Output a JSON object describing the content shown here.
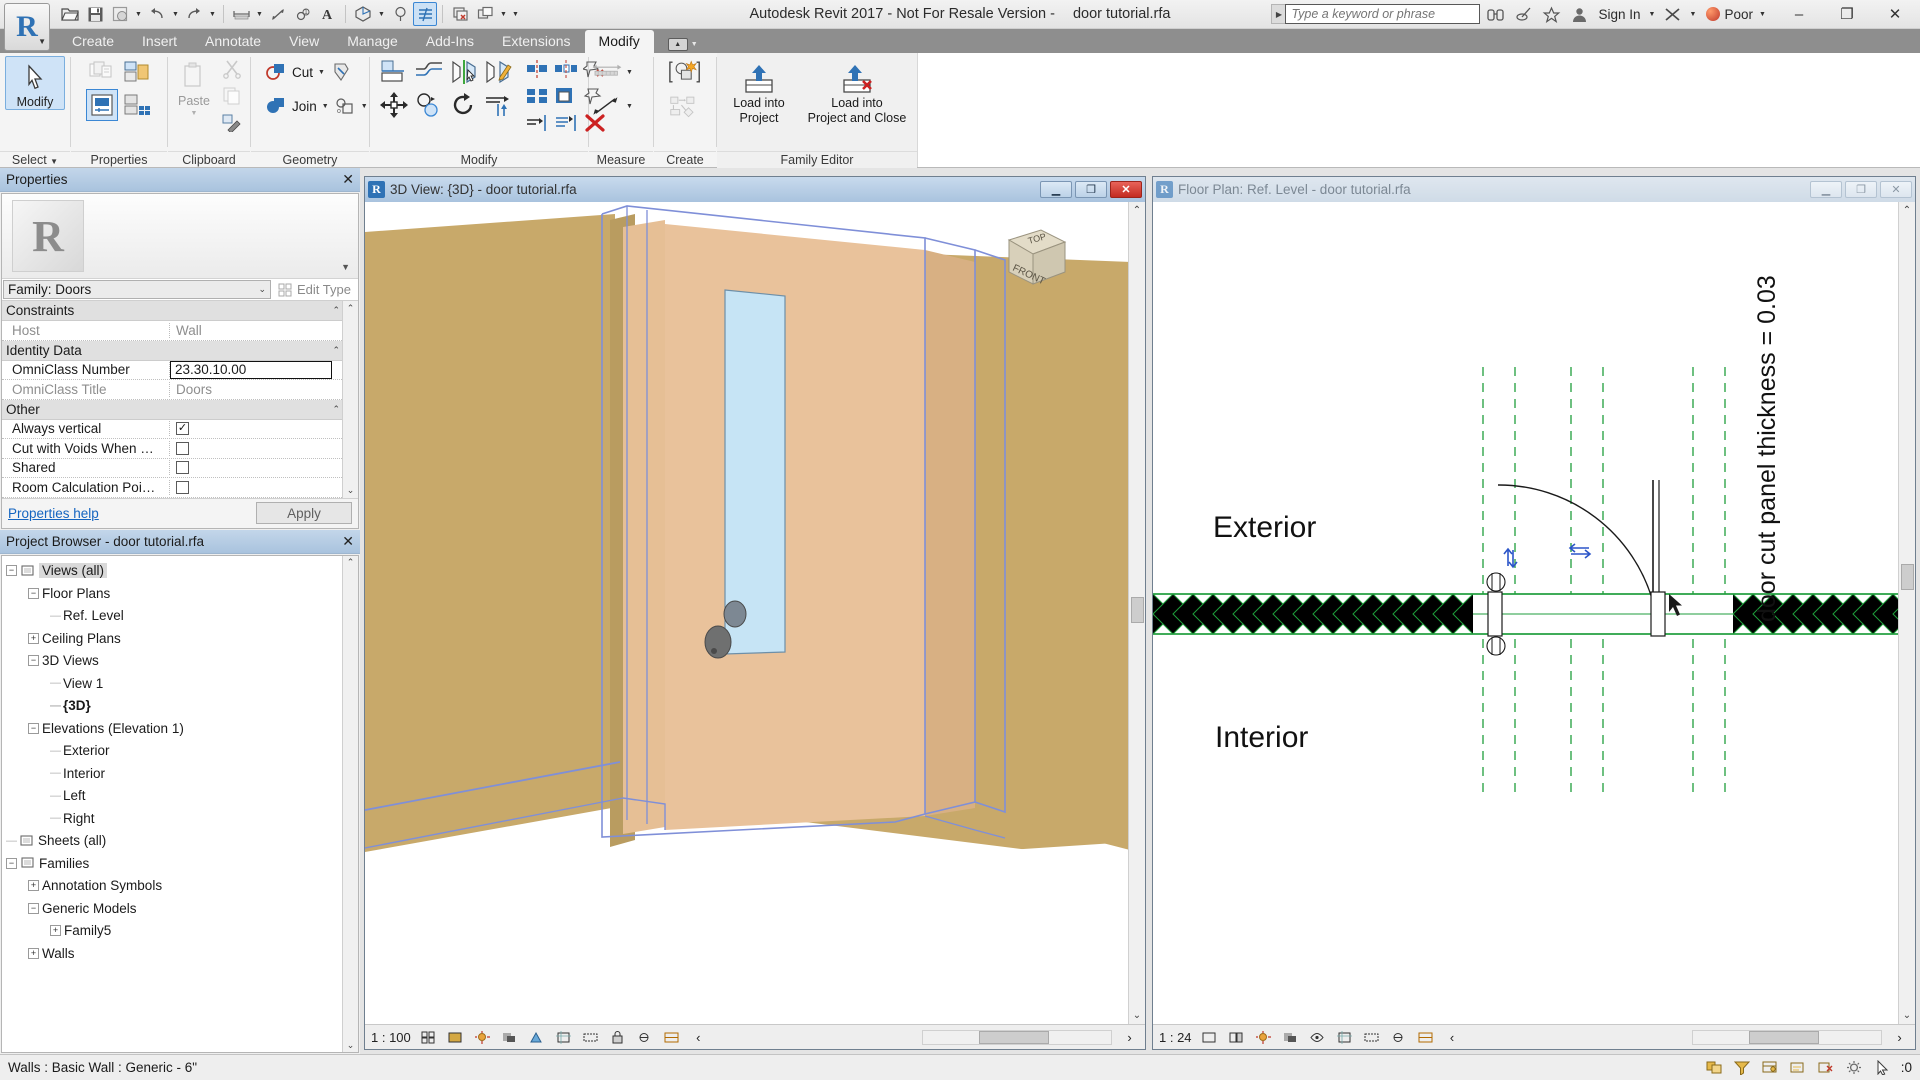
{
  "titlebar": {
    "app_title": "Autodesk Revit 2017 - Not For Resale Version -",
    "file_name": "door tutorial.rfa",
    "search_placeholder": "Type a keyword or phrase",
    "sign_in": "Sign In",
    "quality_label": "Poor",
    "quick_access": [
      {
        "name": "open-icon"
      },
      {
        "name": "save-icon"
      },
      {
        "name": "save-as-icon"
      },
      {
        "name": "undo-icon"
      },
      {
        "name": "redo-icon"
      },
      {
        "name": "measure-icon"
      },
      {
        "name": "aligned-dimension-icon"
      },
      {
        "name": "tag-icon"
      },
      {
        "name": "text-icon"
      },
      {
        "name": "default-3d-view-icon"
      },
      {
        "name": "section-icon"
      },
      {
        "name": "thin-lines-icon"
      },
      {
        "name": "close-hidden-windows-icon"
      },
      {
        "name": "switch-windows-icon"
      }
    ],
    "window_buttons": {
      "minimize": "–",
      "maximize": "❐",
      "close": "✕"
    }
  },
  "ribbon": {
    "tabs": [
      {
        "label": "Create",
        "active": false
      },
      {
        "label": "Insert",
        "active": false
      },
      {
        "label": "Annotate",
        "active": false
      },
      {
        "label": "View",
        "active": false
      },
      {
        "label": "Manage",
        "active": false
      },
      {
        "label": "Add-Ins",
        "active": false
      },
      {
        "label": "Extensions",
        "active": false
      },
      {
        "label": "Modify",
        "active": true
      }
    ],
    "panels": [
      {
        "label": "Select"
      },
      {
        "label": "Properties"
      },
      {
        "label": "Clipboard"
      },
      {
        "label": "Geometry"
      },
      {
        "label": "Modify"
      },
      {
        "label": "Measure"
      },
      {
        "label": "Create"
      },
      {
        "label": "Family Editor"
      }
    ],
    "modify_button": "Modify",
    "paste_button": "Paste",
    "cut_button": "Cut",
    "join_button": "Join",
    "load_into_project": "Load into\nProject",
    "load_into_project_l1": "Load into",
    "load_into_project_l2": "Project",
    "load_into_project_and_close_l1": "Load into",
    "load_into_project_and_close_l2": "Project and Close"
  },
  "properties": {
    "panel_title": "Properties",
    "family_selector": "Family: Doors",
    "edit_type_label": "Edit Type",
    "groups": [
      {
        "name": "Constraints",
        "rows": [
          {
            "name": "Host",
            "value": "Wall",
            "type": "text",
            "dim": true
          }
        ]
      },
      {
        "name": "Identity Data",
        "rows": [
          {
            "name": "OmniClass Number",
            "value": "23.30.10.00",
            "type": "text",
            "editing": true
          },
          {
            "name": "OmniClass Title",
            "value": "Doors",
            "type": "text",
            "dim": true
          }
        ]
      },
      {
        "name": "Other",
        "rows": [
          {
            "name": "Always vertical",
            "value": "",
            "type": "checkbox",
            "checked": true
          },
          {
            "name": "Cut with Voids When …",
            "value": "",
            "type": "checkbox",
            "checked": false
          },
          {
            "name": "Shared",
            "value": "",
            "type": "checkbox",
            "checked": false
          },
          {
            "name": "Room Calculation Poi…",
            "value": "",
            "type": "checkbox",
            "checked": false
          }
        ]
      }
    ],
    "help_link": "Properties help",
    "apply_button": "Apply"
  },
  "project_browser": {
    "panel_title": "Project Browser - door tutorial.rfa",
    "tree": [
      {
        "label": "Views (all)",
        "depth": 0,
        "expander": "minus",
        "icon": "views-icon",
        "selected": true
      },
      {
        "label": "Floor Plans",
        "depth": 1,
        "expander": "minus"
      },
      {
        "label": "Ref. Level",
        "depth": 2,
        "expander": "none"
      },
      {
        "label": "Ceiling Plans",
        "depth": 1,
        "expander": "plus"
      },
      {
        "label": "3D Views",
        "depth": 1,
        "expander": "minus"
      },
      {
        "label": "View 1",
        "depth": 2,
        "expander": "none"
      },
      {
        "label": "{3D}",
        "depth": 2,
        "expander": "none",
        "bold": true
      },
      {
        "label": "Elevations (Elevation 1)",
        "depth": 1,
        "expander": "minus"
      },
      {
        "label": "Exterior",
        "depth": 2,
        "expander": "none"
      },
      {
        "label": "Interior",
        "depth": 2,
        "expander": "none"
      },
      {
        "label": "Left",
        "depth": 2,
        "expander": "none"
      },
      {
        "label": "Right",
        "depth": 2,
        "expander": "none"
      },
      {
        "label": "Sheets (all)",
        "depth": 0,
        "expander": "none",
        "icon": "sheets-icon"
      },
      {
        "label": "Families",
        "depth": 0,
        "expander": "minus",
        "icon": "families-icon"
      },
      {
        "label": "Annotation Symbols",
        "depth": 1,
        "expander": "plus"
      },
      {
        "label": "Generic Models",
        "depth": 1,
        "expander": "minus"
      },
      {
        "label": "Family5",
        "depth": 2,
        "expander": "plus"
      },
      {
        "label": "Walls",
        "depth": 1,
        "expander": "plus"
      }
    ]
  },
  "view_3d": {
    "title": "3D View: {3D} - door tutorial.rfa",
    "scale": "1 : 100",
    "viewcube": {
      "top": "TOP",
      "front": "FRONT"
    },
    "toolbar_icons": [
      "scale-icon",
      "detail-level-icon",
      "visual-style-icon",
      "sun-path-icon",
      "shadows-icon",
      "render-icon",
      "crop-view-icon",
      "crop-region-icon",
      "lock-3d-view-icon",
      "temporary-hide-icon",
      "reveal-hidden-icon",
      "left-arrow-icon"
    ]
  },
  "view_plan": {
    "title": "Floor Plan: Ref. Level - door tutorial.rfa",
    "scale": "1 : 24",
    "labels": {
      "exterior": "Exterior",
      "interior": "Interior",
      "dimension": "door cut panel thickness = 0.03"
    },
    "toolbar_icons": [
      "scale-icon",
      "detail-level-icon",
      "visual-style-icon",
      "sun-path-icon",
      "shadows-icon",
      "crop-view-icon",
      "crop-region-icon",
      "temporary-hide-icon",
      "reveal-hidden-icon",
      "left-arrow-icon"
    ]
  },
  "status_bar": {
    "message": "Walls : Basic Wall : Generic - 6\"",
    "selection_count": ":0",
    "right_icons": [
      "design-options-icon",
      "filter-icon",
      "worksets-icon",
      "editable-only-icon",
      "exclude-options-icon",
      "settings-icon",
      "selection-count-icon"
    ]
  }
}
